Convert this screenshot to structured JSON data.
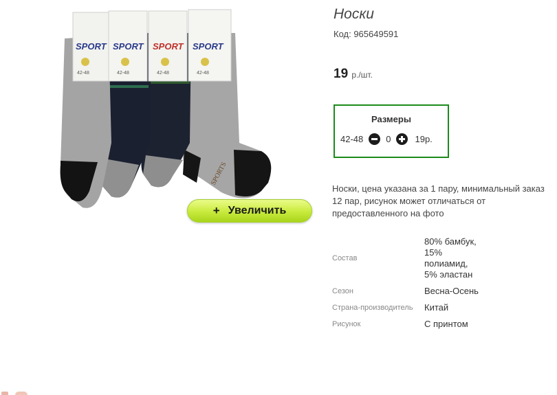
{
  "product": {
    "title": "Носки",
    "code": "Код: 965649591",
    "price": "19",
    "price_unit": "р./шт.",
    "zoom_label": "Увеличить",
    "zoom_plus": "+",
    "image_icon": "socks-product-photo",
    "label_text": "SPORT",
    "label_size": "42-48",
    "sock_print": "SPORTS"
  },
  "sizes": {
    "title": "Размеры",
    "rows": [
      {
        "size": "42-48",
        "qty": "0",
        "price": "19р."
      }
    ],
    "minus_icon": "minus-circle-icon",
    "plus_icon": "plus-circle-icon",
    "border_color": "#1a8b1a"
  },
  "description": "Носки, цена указана за 1 пару, минимальный заказ 12 пар, рисунок может отличаться от предоставленного на фото",
  "specs": [
    {
      "name": "Состав",
      "value": "80% бамбук, 15% полиамид, 5% эластан"
    },
    {
      "name": "Сезон",
      "value": "Весна-Осень"
    },
    {
      "name": "Страна-производитель",
      "value": "Китай"
    },
    {
      "name": "Рисунок",
      "value": "С принтом"
    }
  ],
  "colors": {
    "zoom_button": "#c8ea3c",
    "sizes_border": "#1a8b1a"
  }
}
